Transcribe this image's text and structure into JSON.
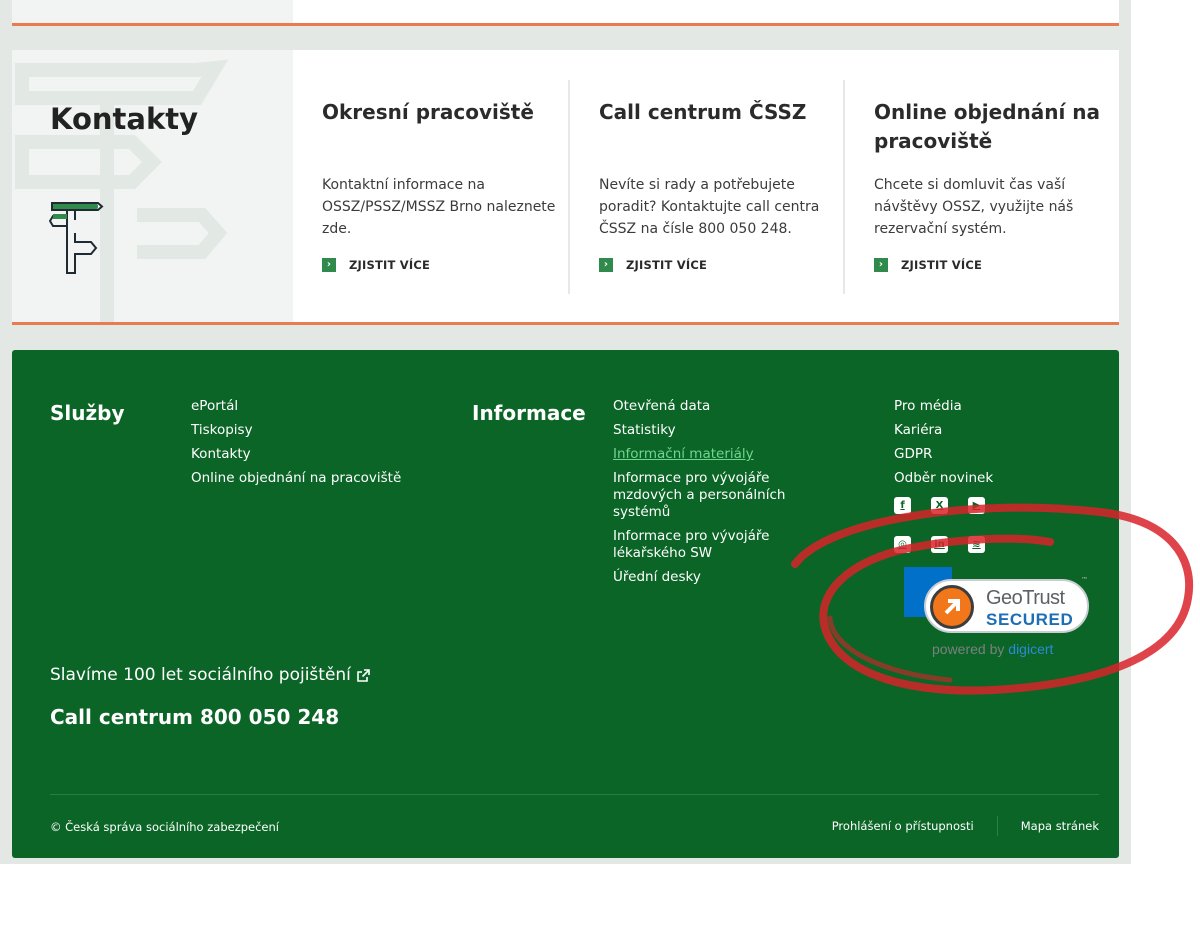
{
  "contacts": {
    "title": "Kontakty",
    "columns": [
      {
        "title": "Okresní pracoviště",
        "text": "Kontaktní informace na OSSZ/PSSZ/MSSZ Brno naleznete zde.",
        "link": "ZJISTIT VÍCE"
      },
      {
        "title": "Call centrum ČSSZ",
        "text": "Nevíte si rady a potřebujete poradit? Kontaktujte call centra ČSSZ na čísle 800 050 248.",
        "link": "ZJISTIT VÍCE"
      },
      {
        "title": "Online objednání na pracoviště",
        "text": "Chcete si domluvit čas vaší návštěvy OSSZ, využijte náš rezervační systém.",
        "link": "ZJISTIT VÍCE"
      }
    ]
  },
  "footer": {
    "sluzby_heading": "Služby",
    "sluzby_links": [
      "ePortál",
      "Tiskopisy",
      "Kontakty",
      "Online objednání na pracoviště"
    ],
    "informace_heading": "Informace",
    "informace_links": [
      "Otevřená data",
      "Statistiky",
      "Informační materiály",
      "Informace pro vývojáře mzdových a personálních systémů",
      "Informace pro vývojáře lékařského SW",
      "Úřední desky"
    ],
    "other_links": [
      "Pro média",
      "Kariéra",
      "GDPR",
      "Odběr novinek"
    ],
    "social_icons": [
      "facebook-icon",
      "x-icon",
      "youtube-icon",
      "instagram-icon",
      "linkedin-icon",
      "rss-icon"
    ],
    "celebrate": "Slavíme 100 let sociálního pojištění",
    "call_center": "Call centrum 800 050 248",
    "copyright": "© Česká správa sociálního zabezpečení",
    "accessibility": "Prohlášení o přístupnosti",
    "sitemap": "Mapa stránek"
  },
  "geotrust": {
    "name": "GeoTrust",
    "secured": "SECURED",
    "tm": "™",
    "powered": "powered by ",
    "brand": "digicert"
  },
  "colors": {
    "footer_green": "#0b6526",
    "accent_orange": "#ea7a4f",
    "annotation_red": "#d8232a"
  }
}
